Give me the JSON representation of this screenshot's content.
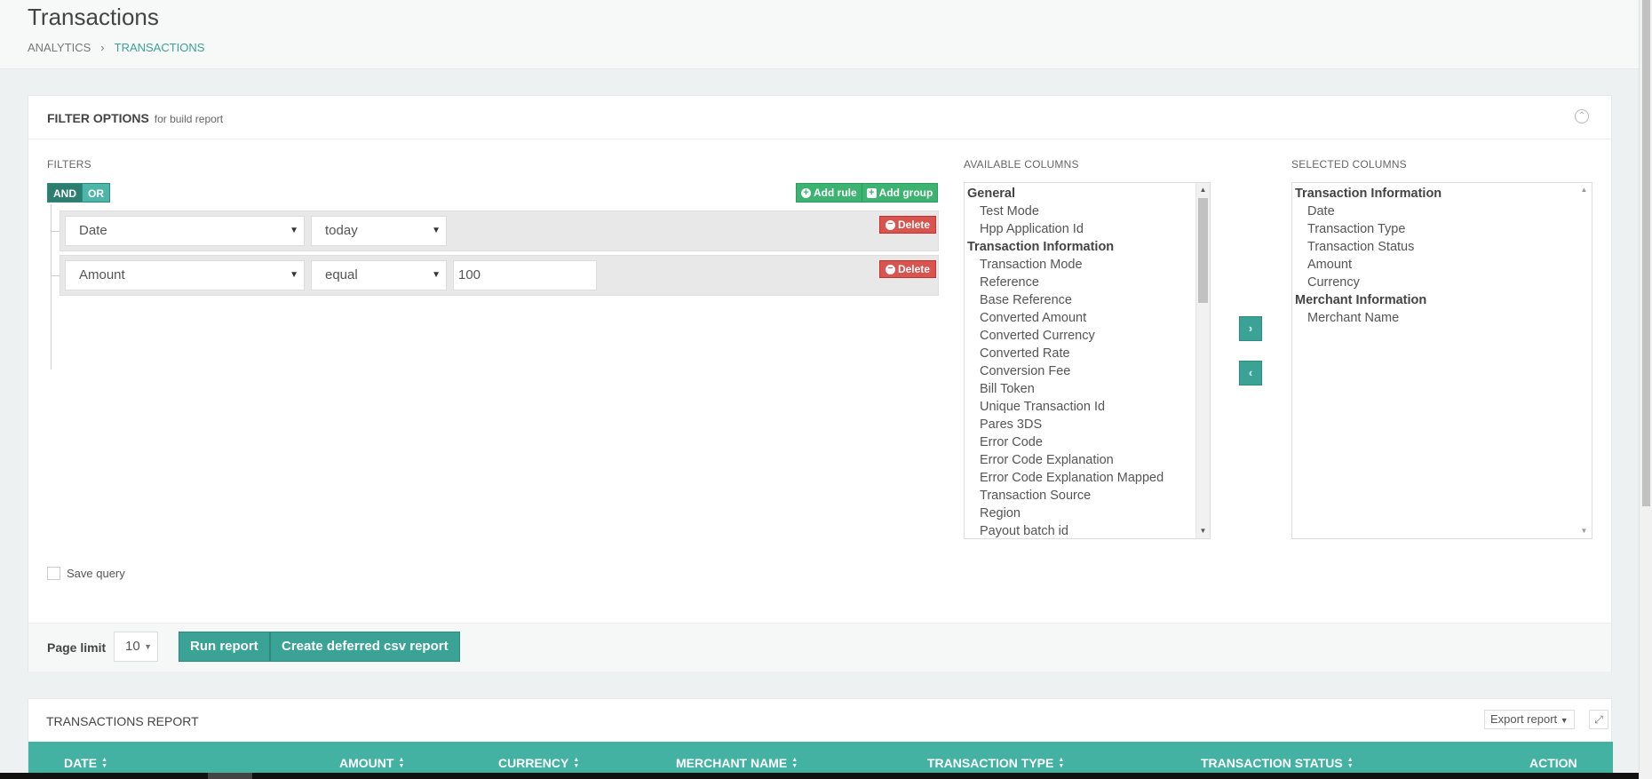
{
  "page": {
    "title": "Transactions",
    "breadcrumb": [
      "ANALYTICS",
      "TRANSACTIONS"
    ]
  },
  "filter_panel": {
    "title": "FILTER OPTIONS",
    "subtitle": "for build report",
    "filters_label": "FILTERS",
    "and_label": "AND",
    "or_label": "OR",
    "add_rule_label": "Add rule",
    "add_group_label": "Add group",
    "delete_label": "Delete",
    "rules": [
      {
        "field": "Date",
        "operator": "today",
        "value": ""
      },
      {
        "field": "Amount",
        "operator": "equal",
        "value": "100"
      }
    ],
    "available_label": "AVAILABLE COLUMNS",
    "selected_label": "SELECTED COLUMNS",
    "available_columns": [
      {
        "type": "group",
        "label": "General"
      },
      {
        "type": "item",
        "label": "Test Mode"
      },
      {
        "type": "item",
        "label": "Hpp Application Id"
      },
      {
        "type": "group",
        "label": "Transaction Information"
      },
      {
        "type": "item",
        "label": "Transaction Mode"
      },
      {
        "type": "item",
        "label": "Reference"
      },
      {
        "type": "item",
        "label": "Base Reference"
      },
      {
        "type": "item",
        "label": "Converted Amount"
      },
      {
        "type": "item",
        "label": "Converted Currency"
      },
      {
        "type": "item",
        "label": "Converted Rate"
      },
      {
        "type": "item",
        "label": "Conversion Fee"
      },
      {
        "type": "item",
        "label": "Bill Token"
      },
      {
        "type": "item",
        "label": "Unique Transaction Id"
      },
      {
        "type": "item",
        "label": "Pares 3DS"
      },
      {
        "type": "item",
        "label": "Error Code"
      },
      {
        "type": "item",
        "label": "Error Code Explanation"
      },
      {
        "type": "item",
        "label": "Error Code Explanation Mapped"
      },
      {
        "type": "item",
        "label": "Transaction Source"
      },
      {
        "type": "item",
        "label": "Region"
      },
      {
        "type": "item",
        "label": "Payout batch id"
      }
    ],
    "selected_columns": [
      {
        "type": "group",
        "label": "Transaction Information"
      },
      {
        "type": "item",
        "label": "Date"
      },
      {
        "type": "item",
        "label": "Transaction Type"
      },
      {
        "type": "item",
        "label": "Transaction Status"
      },
      {
        "type": "item",
        "label": "Amount"
      },
      {
        "type": "item",
        "label": "Currency"
      },
      {
        "type": "group",
        "label": "Merchant Information"
      },
      {
        "type": "item",
        "label": "Merchant Name"
      }
    ],
    "move_right_icon": "›",
    "move_left_icon": "‹",
    "save_query_label": "Save query",
    "page_limit_label": "Page limit",
    "page_limit_value": "10",
    "run_report_label": "Run report",
    "deferred_csv_label": "Create deferred csv report"
  },
  "report_panel": {
    "title": "TRANSACTIONS REPORT",
    "export_label": "Export report",
    "columns": [
      "DATE",
      "AMOUNT",
      "CURRENCY",
      "MERCHANT NAME",
      "TRANSACTION TYPE",
      "TRANSACTION STATUS",
      "ACTION"
    ]
  },
  "colors": {
    "accent": "#3aa395",
    "table_header": "#43b2a3",
    "add_button": "#3cb371",
    "delete_button": "#d9534f"
  }
}
